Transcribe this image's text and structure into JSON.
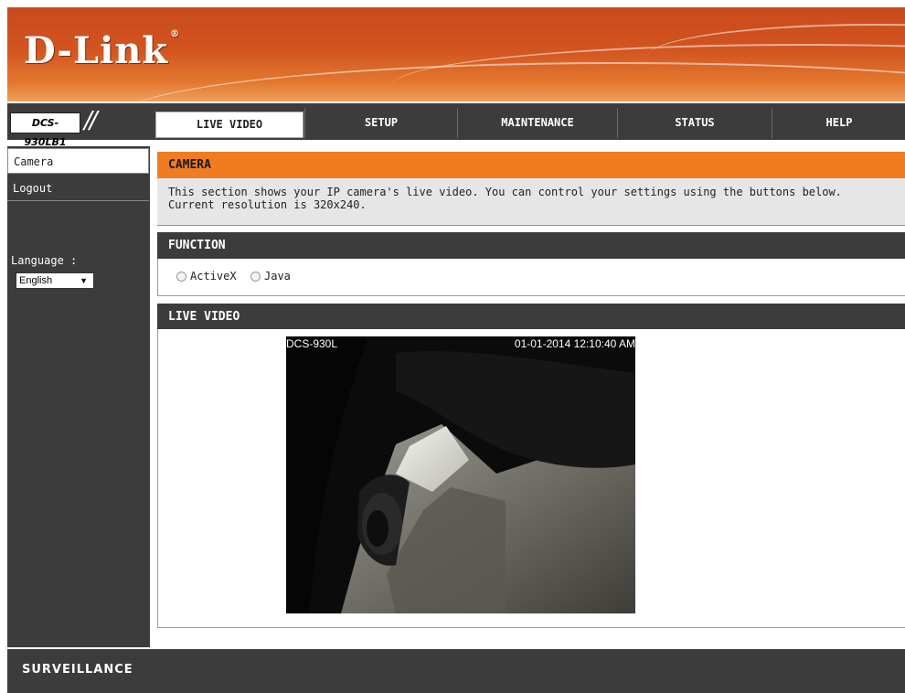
{
  "brand": {
    "logo_text": "D-Link",
    "reg_mark": "®"
  },
  "navbar": {
    "model": "DCS-930LB1",
    "slashes": "//",
    "tabs": [
      "LIVE VIDEO",
      "SETUP",
      "MAINTENANCE",
      "STATUS",
      "HELP"
    ],
    "active_tab": "LIVE VIDEO"
  },
  "sidebar": {
    "items": [
      {
        "label": "Camera",
        "selected": true
      },
      {
        "label": "Logout",
        "selected": false
      }
    ],
    "language_label": "Language :",
    "language_selected": "English",
    "dropdown_arrow": "▼"
  },
  "camera_section": {
    "title": "CAMERA",
    "description_line1": "This section shows your IP camera's live video. You can control your settings using the buttons below.",
    "description_line2": "Current resolution is 320x240."
  },
  "function_section": {
    "title": "FUNCTION",
    "options": [
      "ActiveX",
      "Java"
    ]
  },
  "live_video_section": {
    "title": "LIVE VIDEO",
    "osd_camera_name": "DCS-930L",
    "osd_timestamp": "01-01-2014 12:10:40 AM"
  },
  "footer": {
    "text": "SURVEILLANCE"
  },
  "colors": {
    "orange_accent": "#f07c22",
    "dark_gray": "#3c3c3c",
    "banner_orange": "#d2541f"
  }
}
